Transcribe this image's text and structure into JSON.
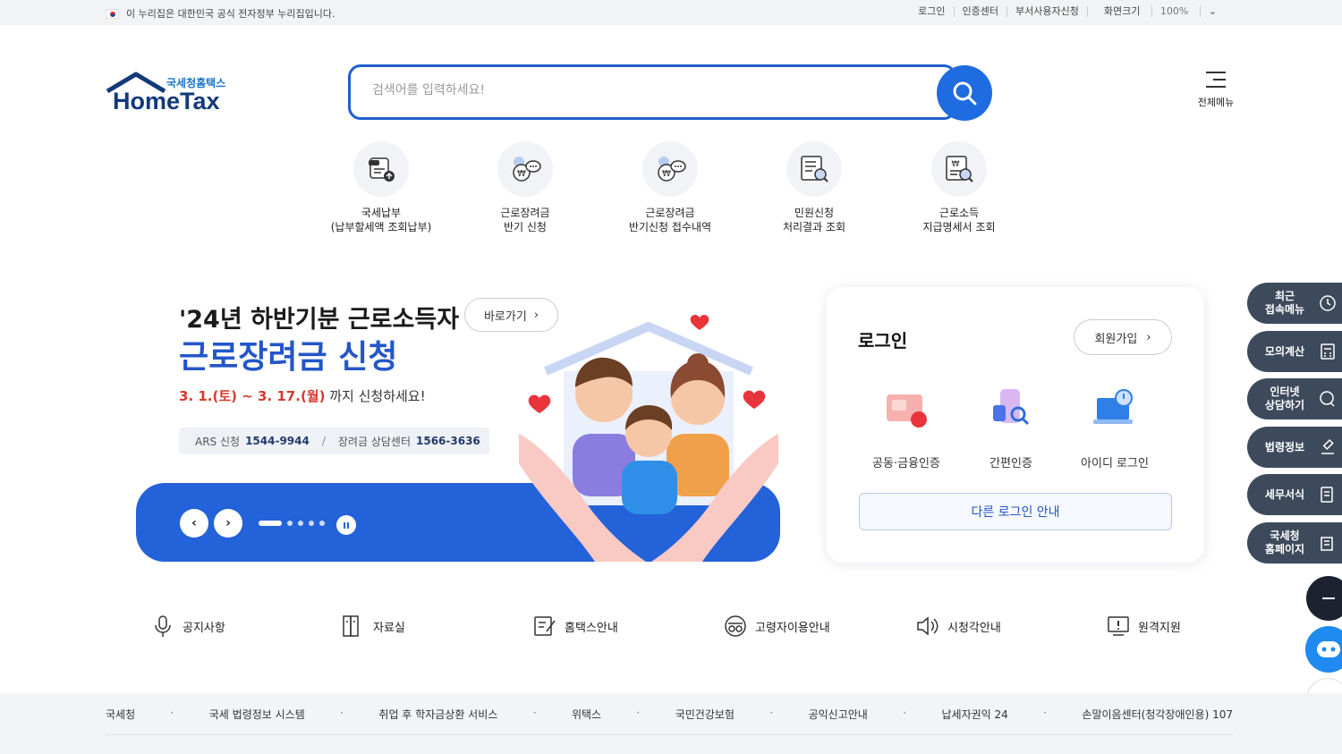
{
  "gov_bar": {
    "notice": "이 누리집은 대한민국 공식 전자정부 누리집입니다.",
    "links": [
      "로그인",
      "인증센터",
      "부서사용자신청"
    ],
    "zoom_label": "화면크기",
    "zoom_value": "100%"
  },
  "header": {
    "logo_sub": "국세청홈택스",
    "logo_main": "HomeTax",
    "search_placeholder": "검색어를 입력하세요!",
    "all_menu_label": "전체메뉴"
  },
  "quick_menu": [
    {
      "line1": "국세납부",
      "line2": "(납부할세액 조회납부)",
      "icon": "tax-payment-icon"
    },
    {
      "line1": "근로장려금",
      "line2": "반기 신청",
      "icon": "money-chat-icon"
    },
    {
      "line1": "근로장려금",
      "line2": "반기신청 접수내역",
      "icon": "money-chat-icon"
    },
    {
      "line1": "민원신청",
      "line2": "처리결과 조회",
      "icon": "document-search-icon"
    },
    {
      "line1": "근로소득",
      "line2": "지급명세서 조회",
      "icon": "statement-search-icon"
    }
  ],
  "banner": {
    "title_line1": "'24년 하반기분 근로소득자",
    "title_line2": "근로장려금 신청",
    "goto_label": "바로가기",
    "period_highlight": "3. 1.(토) ~ 3. 17.(월)",
    "period_suffix": " 까지 신청하세요!",
    "ars_label": "ARS 신청",
    "ars_number": "1544-9944",
    "center_label": "장려금 상담센터",
    "center_number": "1566-3636",
    "separator": "/",
    "slide_count": 5,
    "active_slide": 1
  },
  "login": {
    "title": "로그인",
    "signup_label": "회원가입",
    "options": [
      "공동·금융인증",
      "간편인증",
      "아이디 로그인"
    ],
    "other_login_label": "다른 로그인 안내"
  },
  "side_panel": [
    {
      "label": "최근\n접속메뉴",
      "icon": "clock-icon"
    },
    {
      "label": "모의계산",
      "icon": "calculator-icon"
    },
    {
      "label": "인터넷\n상담하기",
      "icon": "chat-icon"
    },
    {
      "label": "법령정보",
      "icon": "gavel-icon"
    },
    {
      "label": "세무서식",
      "icon": "form-icon"
    },
    {
      "label": "국세청\n홈페이지",
      "icon": "building-icon"
    }
  ],
  "bottom_menu": [
    "공지사항",
    "자료실",
    "홈택스안내",
    "고령자이용안내",
    "시청각안내",
    "원격지원"
  ],
  "footer_links": [
    "국세청",
    "국세 법령정보 시스템",
    "취업 후 학자금상환 서비스",
    "위택스",
    "국민건강보험",
    "공익신고안내",
    "납세자권익 24",
    "손말이음센터(청각장애인용) 107"
  ],
  "colors": {
    "brand_blue": "#2462d9",
    "search_border": "#1f5fcf",
    "side_panel": "#3d4a5c",
    "period_red": "#d33a2c"
  }
}
